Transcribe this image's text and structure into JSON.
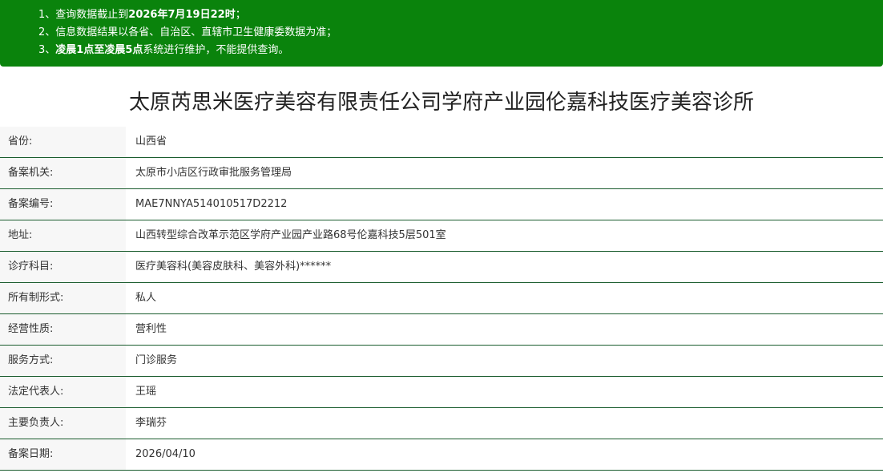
{
  "notice": {
    "line1_prefix": "1、查询数据截止到",
    "line1_bold": "2026年7月19日22时",
    "line1_suffix": "；",
    "line2": "2、信息数据结果以各省、自治区、直辖市卫生健康委数据为准；",
    "line3_prefix": "3、",
    "line3_bold": "凌晨1点至凌晨5点",
    "line3_suffix": "系统进行维护，不能提供查询。",
    "background": "#0a830c"
  },
  "title": "太原芮思米医疗美容有限责任公司学府产业园伦嘉科技医疗美容诊所",
  "rows": [
    {
      "label": "省份:",
      "value": "山西省"
    },
    {
      "label": "备案机关:",
      "value": "太原市小店区行政审批服务管理局"
    },
    {
      "label": "备案编号:",
      "value": "MAE7NNYA514010517D2212"
    },
    {
      "label": "地址:",
      "value": "山西转型综合改革示范区学府产业园产业路68号伦嘉科技5层501室"
    },
    {
      "label": "诊疗科目:",
      "value": "医疗美容科(美容皮肤科、美容外科)******"
    },
    {
      "label": "所有制形式:",
      "value": "私人"
    },
    {
      "label": "经营性质:",
      "value": "营利性"
    },
    {
      "label": "服务方式:",
      "value": "门诊服务"
    },
    {
      "label": "法定代表人:",
      "value": "王瑶"
    },
    {
      "label": "主要负责人:",
      "value": "李瑞芬"
    },
    {
      "label": "备案日期:",
      "value": "2026/04/10"
    }
  ]
}
